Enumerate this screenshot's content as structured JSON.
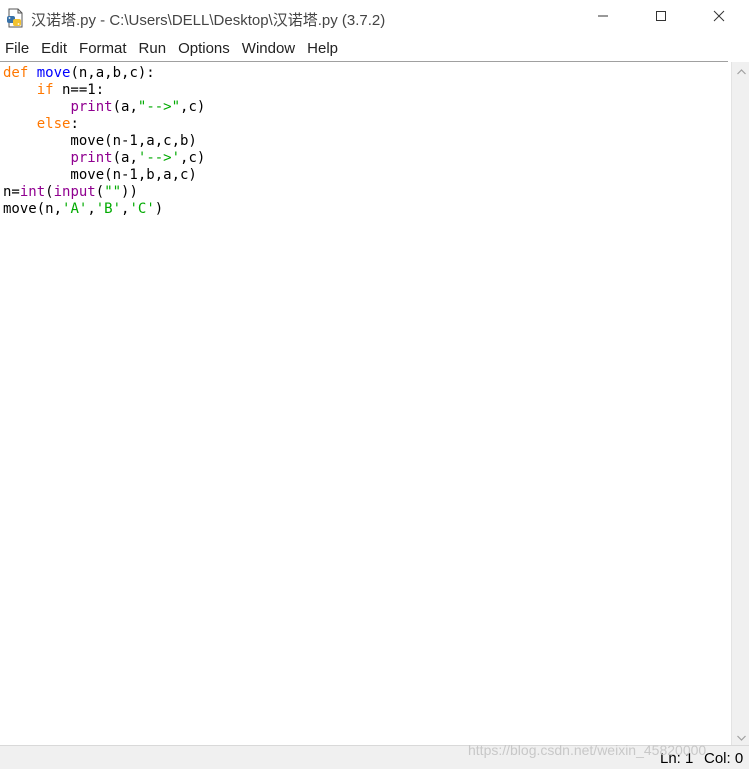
{
  "window": {
    "title": "汉诺塔.py - C:\\Users\\DELL\\Desktop\\汉诺塔.py (3.7.2)"
  },
  "menu": [
    "File",
    "Edit",
    "Format",
    "Run",
    "Options",
    "Window",
    "Help"
  ],
  "code": {
    "line1": {
      "kw": "def",
      "sp": " ",
      "name": "move",
      "rest": "(n,a,b,c):"
    },
    "line2": {
      "indent": "    ",
      "kw": "if",
      "rest": " n==1:"
    },
    "line3": {
      "indent": "        ",
      "bi": "print",
      "pre": "(a,",
      "str": "\"-->\"",
      "post": ",c)"
    },
    "line4": {
      "indent": "    ",
      "kw": "else",
      "rest": ":"
    },
    "line5": {
      "text": "        move(n-1,a,c,b)"
    },
    "line6": {
      "indent": "        ",
      "bi": "print",
      "pre": "(a,",
      "str": "'-->'",
      "post": ",c)"
    },
    "line7": {
      "text": "        move(n-1,b,a,c)"
    },
    "line8": {
      "pre": "n=",
      "bi1": "int",
      "mid": "(",
      "bi2": "input",
      "open": "(",
      "str": "\"\"",
      "post": "))"
    },
    "line9": {
      "pre": "move(n,",
      "s1": "'A'",
      "c1": ",",
      "s2": "'B'",
      "c2": ",",
      "s3": "'C'",
      "post": ")"
    }
  },
  "status": {
    "line": "Ln: 1",
    "col": "Col: 0"
  },
  "watermark": "https://blog.csdn.net/weixin_45820000",
  "colors": {
    "keyword": "#ff7700",
    "definition": "#0000ff",
    "builtin": "#900090",
    "string": "#00aa00"
  },
  "icons": {
    "app": "python-file-icon",
    "minimize": "minimize-icon",
    "maximize": "maximize-icon",
    "close": "close-icon"
  }
}
